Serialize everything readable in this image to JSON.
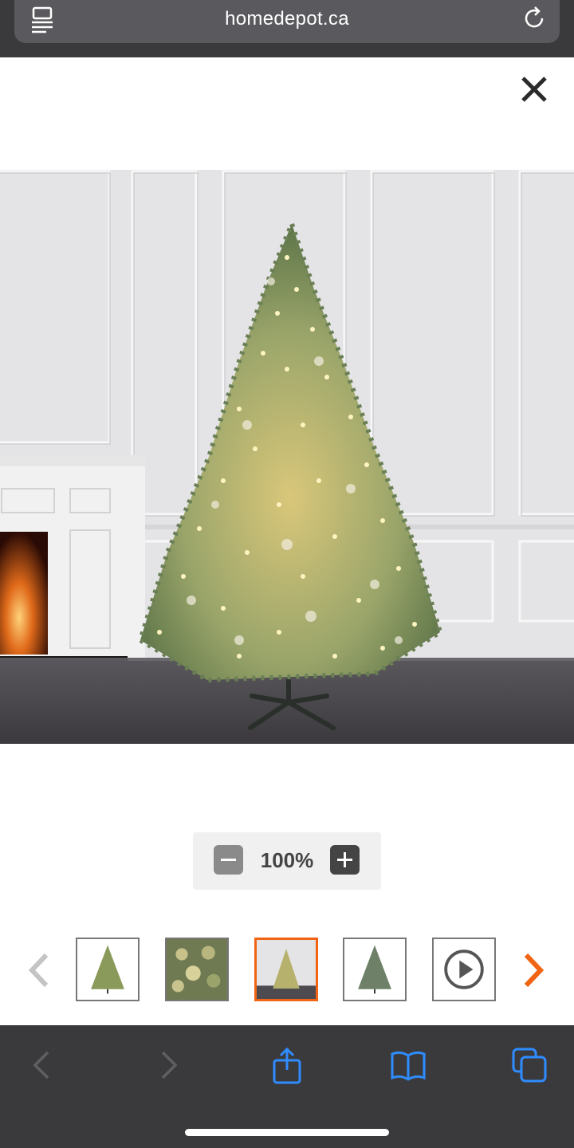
{
  "browser": {
    "url": "homedepot.ca"
  },
  "zoom": {
    "level": "100%"
  },
  "thumbnails": {
    "count": 5,
    "selected_index": 2
  },
  "colors": {
    "accent": "#f06414",
    "toolbar_bg": "#3a3a3c",
    "toolbar_icon": "#2f8cff"
  },
  "icons": {
    "reader": "reader-mode-icon",
    "reload": "reload-icon",
    "close": "close-icon",
    "zoom_out": "minus-icon",
    "zoom_in": "plus-icon",
    "prev": "chevron-left-icon",
    "next": "chevron-right-icon",
    "video": "play-icon",
    "back": "back-icon",
    "forward": "forward-icon",
    "share": "share-icon",
    "bookmarks": "book-icon",
    "tabs": "tabs-icon"
  }
}
